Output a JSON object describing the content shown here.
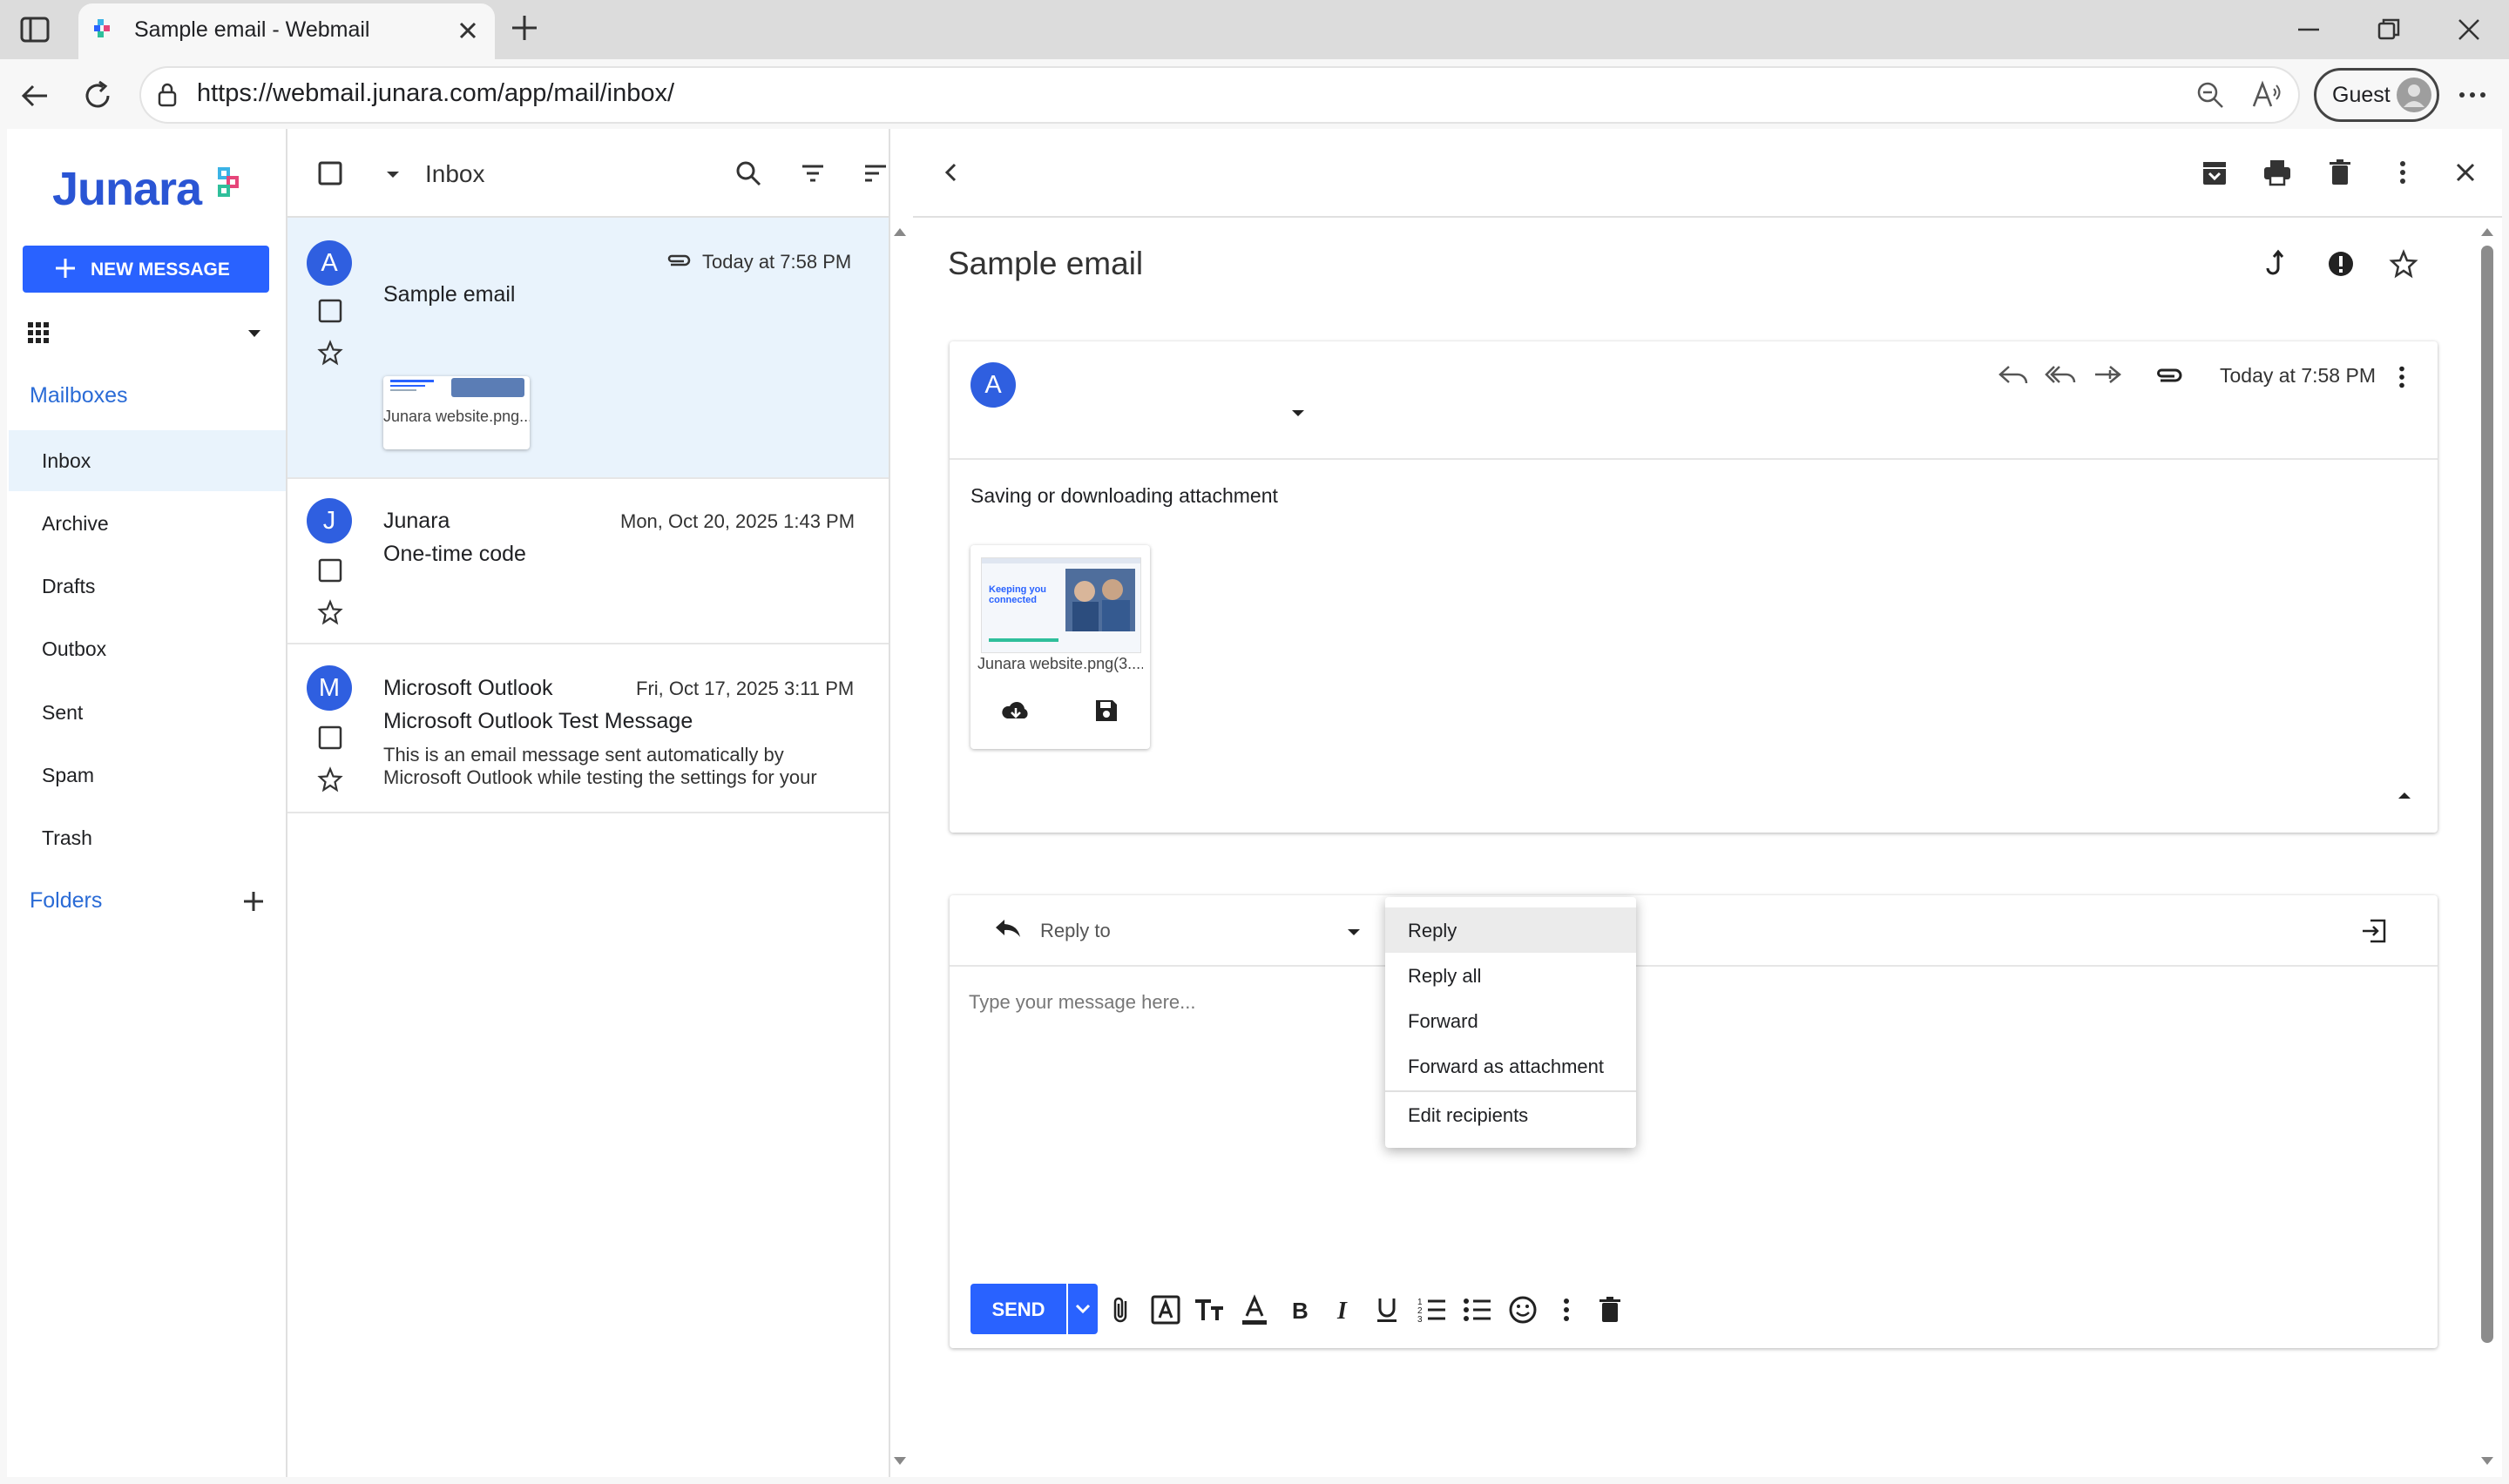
{
  "browser": {
    "tab_title": "Sample email - Webmail",
    "url": "https://webmail.junara.com/app/mail/inbox/",
    "profile_label": "Guest"
  },
  "brand": {
    "logo_text": "Junara",
    "accent": "#2962ff"
  },
  "sidebar": {
    "new_message_label": "NEW MESSAGE",
    "mailboxes_label": "Mailboxes",
    "items": [
      "Inbox",
      "Archive",
      "Drafts",
      "Outbox",
      "Sent",
      "Spam",
      "Trash"
    ],
    "folders_label": "Folders"
  },
  "list": {
    "mailbox_title": "Inbox",
    "emails": [
      {
        "avatar": "A",
        "sender": "",
        "subject": "Sample email",
        "date": "Today at 7:58 PM",
        "attachment_name": "Junara website.png...",
        "selected": true
      },
      {
        "avatar": "J",
        "sender": "Junara",
        "subject": "One-time code",
        "date": "Mon, Oct 20, 2025 1:43 PM"
      },
      {
        "avatar": "M",
        "sender": "Microsoft Outlook",
        "subject": "Microsoft Outlook Test Message",
        "date": "Fri, Oct 17, 2025 3:11 PM",
        "preview_line1": "This is an email message sent automatically by",
        "preview_line2": "Microsoft Outlook while testing the settings for your"
      }
    ]
  },
  "message": {
    "subject": "Sample email",
    "avatar": "A",
    "date": "Today at 7:58 PM",
    "body": "Saving or downloading attachment",
    "attachment_name": "Junara website.png(3....",
    "thumb_text": "Keeping you connected"
  },
  "compose": {
    "reply_to_label": "Reply to",
    "placeholder": "Type your message here...",
    "send_label": "SEND"
  },
  "reply_menu": {
    "items": [
      "Reply",
      "Reply all",
      "Forward",
      "Forward as attachment",
      "Edit recipients"
    ]
  }
}
